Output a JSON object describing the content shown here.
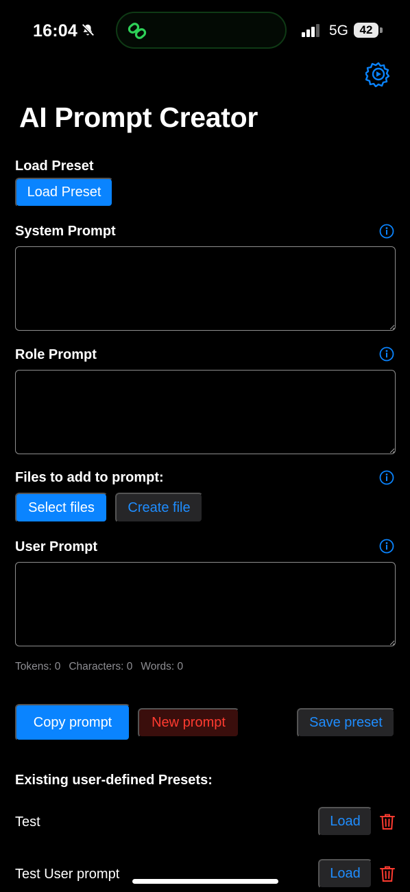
{
  "status_bar": {
    "time": "16:04",
    "network": "5G",
    "battery": "42",
    "island_color": "#2ed158"
  },
  "settings": {
    "icon": "gear-icon"
  },
  "title": "AI Prompt Creator",
  "load_preset": {
    "label": "Load Preset",
    "button": "Load Preset"
  },
  "system_prompt": {
    "label": "System Prompt",
    "value": ""
  },
  "role_prompt": {
    "label": "Role Prompt",
    "value": ""
  },
  "files": {
    "label": "Files to add to prompt:",
    "select_button": "Select files",
    "create_button": "Create file"
  },
  "user_prompt": {
    "label": "User Prompt",
    "value": ""
  },
  "stats": {
    "tokens": "Tokens: 0",
    "characters": "Characters: 0",
    "words": "Words: 0"
  },
  "actions": {
    "copy": "Copy prompt",
    "new": "New prompt",
    "save": "Save preset"
  },
  "presets": {
    "heading": "Existing user-defined Presets:",
    "items": [
      {
        "name": "Test",
        "load_label": "Load"
      },
      {
        "name": "Test User prompt",
        "load_label": "Load"
      }
    ]
  },
  "colors": {
    "accent": "#0a84ff",
    "danger": "#ff3b30",
    "background": "#000000"
  }
}
